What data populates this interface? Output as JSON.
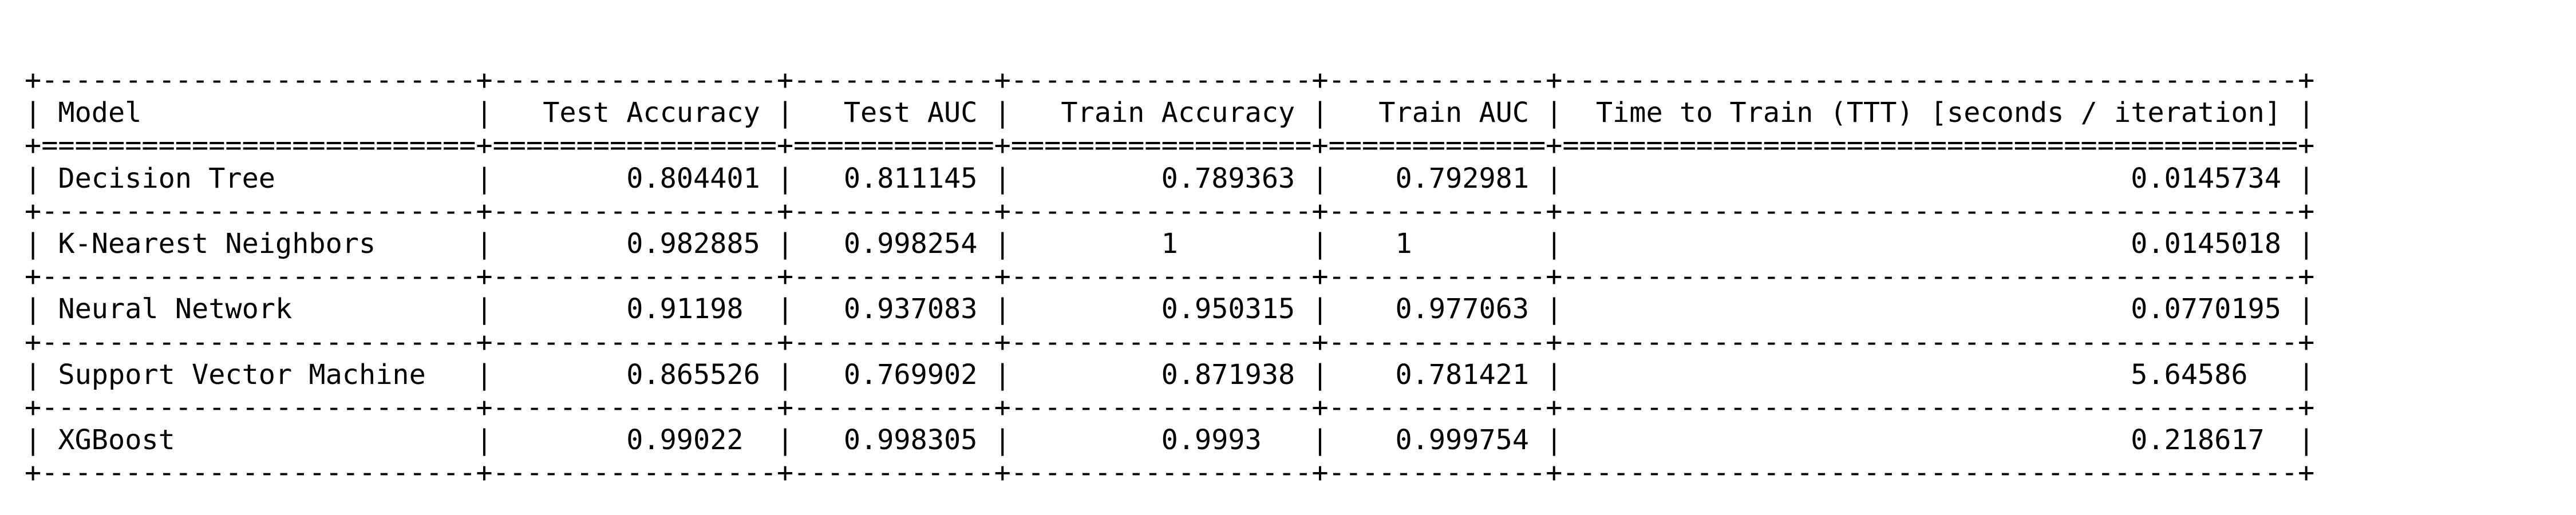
{
  "columns": [
    "Model",
    "Test Accuracy",
    "Test AUC",
    "Train Accuracy",
    "Train AUC",
    "Time to Train (TTT) [seconds / iteration]"
  ],
  "rows": [
    {
      "model": "Decision Tree",
      "test_accuracy": "0.804401",
      "test_auc": "0.811145",
      "train_accuracy": "0.789363",
      "train_auc": "0.792981",
      "ttt": "0.0145734"
    },
    {
      "model": "K-Nearest Neighbors",
      "test_accuracy": "0.982885",
      "test_auc": "0.998254",
      "train_accuracy": "1",
      "train_auc": "1",
      "ttt": "0.0145018"
    },
    {
      "model": "Neural Network",
      "test_accuracy": "0.91198",
      "test_auc": "0.937083",
      "train_accuracy": "0.950315",
      "train_auc": "0.977063",
      "ttt": "0.0770195"
    },
    {
      "model": "Support Vector Machine",
      "test_accuracy": "0.865526",
      "test_auc": "0.769902",
      "train_accuracy": "0.871938",
      "train_auc": "0.781421",
      "ttt": "5.64586"
    },
    {
      "model": "XGBoost",
      "test_accuracy": "0.99022",
      "test_auc": "0.998305",
      "train_accuracy": "0.9993",
      "train_auc": "0.999754",
      "ttt": "0.218617"
    }
  ]
}
